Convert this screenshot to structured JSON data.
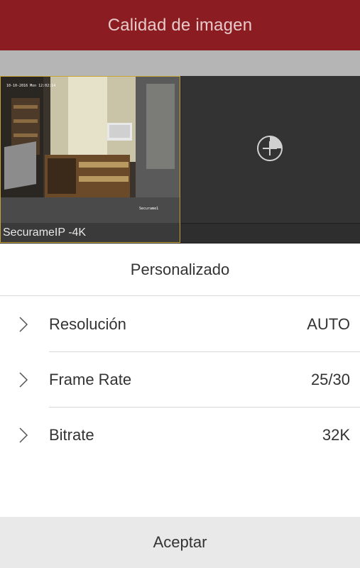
{
  "header": {
    "title": "Calidad de imagen"
  },
  "video": {
    "camera_caption": "SecurameIP -4K",
    "add_icon": "add-camera-icon"
  },
  "panel": {
    "title": "Personalizado",
    "rows": [
      {
        "label": "Resolución",
        "value": "AUTO",
        "icon": "chevron-right-icon"
      },
      {
        "label": "Frame Rate",
        "value": "25/30",
        "icon": "chevron-right-icon"
      },
      {
        "label": "Bitrate",
        "value": "32K",
        "icon": "chevron-right-icon"
      }
    ]
  },
  "footer": {
    "accept_label": "Aceptar"
  },
  "colors": {
    "header_bg": "#8b1d22",
    "selected_border": "#c8a53a"
  }
}
